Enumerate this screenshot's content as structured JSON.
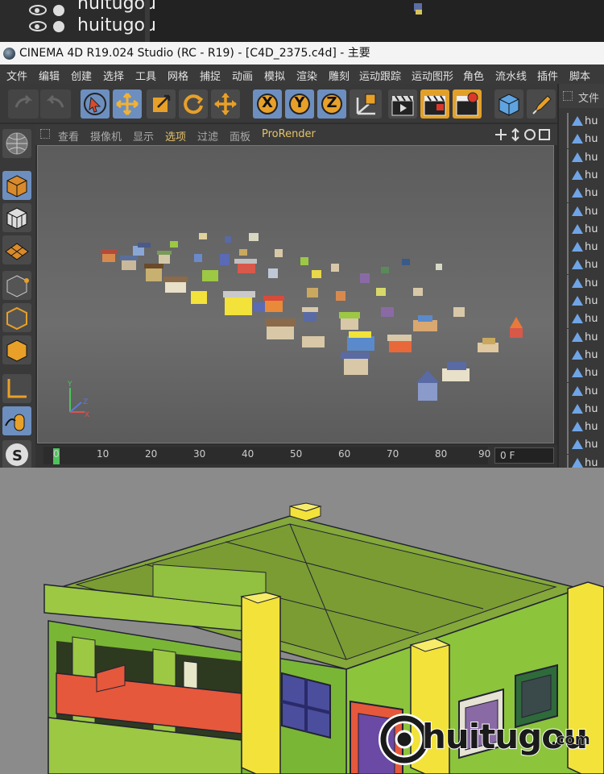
{
  "top_layers": {
    "items": [
      {
        "name": "huitugou"
      },
      {
        "name": "huitugou"
      }
    ]
  },
  "window": {
    "title": "CINEMA 4D R19.024 Studio (RC - R19) - [C4D_2375.c4d] - 主要"
  },
  "menubar": {
    "items": [
      "文件",
      "编辑",
      "创建",
      "选择",
      "工具",
      "网格",
      "捕捉",
      "动画",
      "模拟",
      "渲染",
      "雕刻",
      "运动跟踪",
      "运动图形",
      "角色",
      "流水线",
      "插件",
      "脚本"
    ]
  },
  "toolbar": {
    "tools": [
      "undo",
      "redo",
      "select",
      "move",
      "scale",
      "rotate",
      "multi-transform",
      "x-axis",
      "y-axis",
      "z-axis",
      "coordinate-system",
      "render-view",
      "render-picture-viewer",
      "render-settings",
      "cube",
      "pen"
    ],
    "axis_labels": {
      "x": "X",
      "y": "Y",
      "z": "Z"
    }
  },
  "viewport": {
    "menu": [
      "查看",
      "摄像机",
      "显示",
      "选项",
      "过滤",
      "面板",
      "ProRender"
    ],
    "active_menu": "选项",
    "axis": {
      "x": "X",
      "y": "Y",
      "z": "Z"
    }
  },
  "timeline": {
    "ticks": [
      "0",
      "10",
      "20",
      "30",
      "40",
      "50",
      "60",
      "70",
      "80",
      "90"
    ],
    "current_frame": "0 F"
  },
  "object_manager": {
    "header": "文件",
    "item_label": "hu",
    "row_count": 22
  },
  "watermark": {
    "brand": "huitugou",
    "domain": ".com"
  },
  "colors": {
    "accent_blue": "#6d8fbf",
    "accent_orange": "#e2a02a",
    "active_menu": "#e3c26a",
    "house_green": "#9cc844",
    "house_yellow": "#f2e23a",
    "railing_red": "#e5583b"
  }
}
